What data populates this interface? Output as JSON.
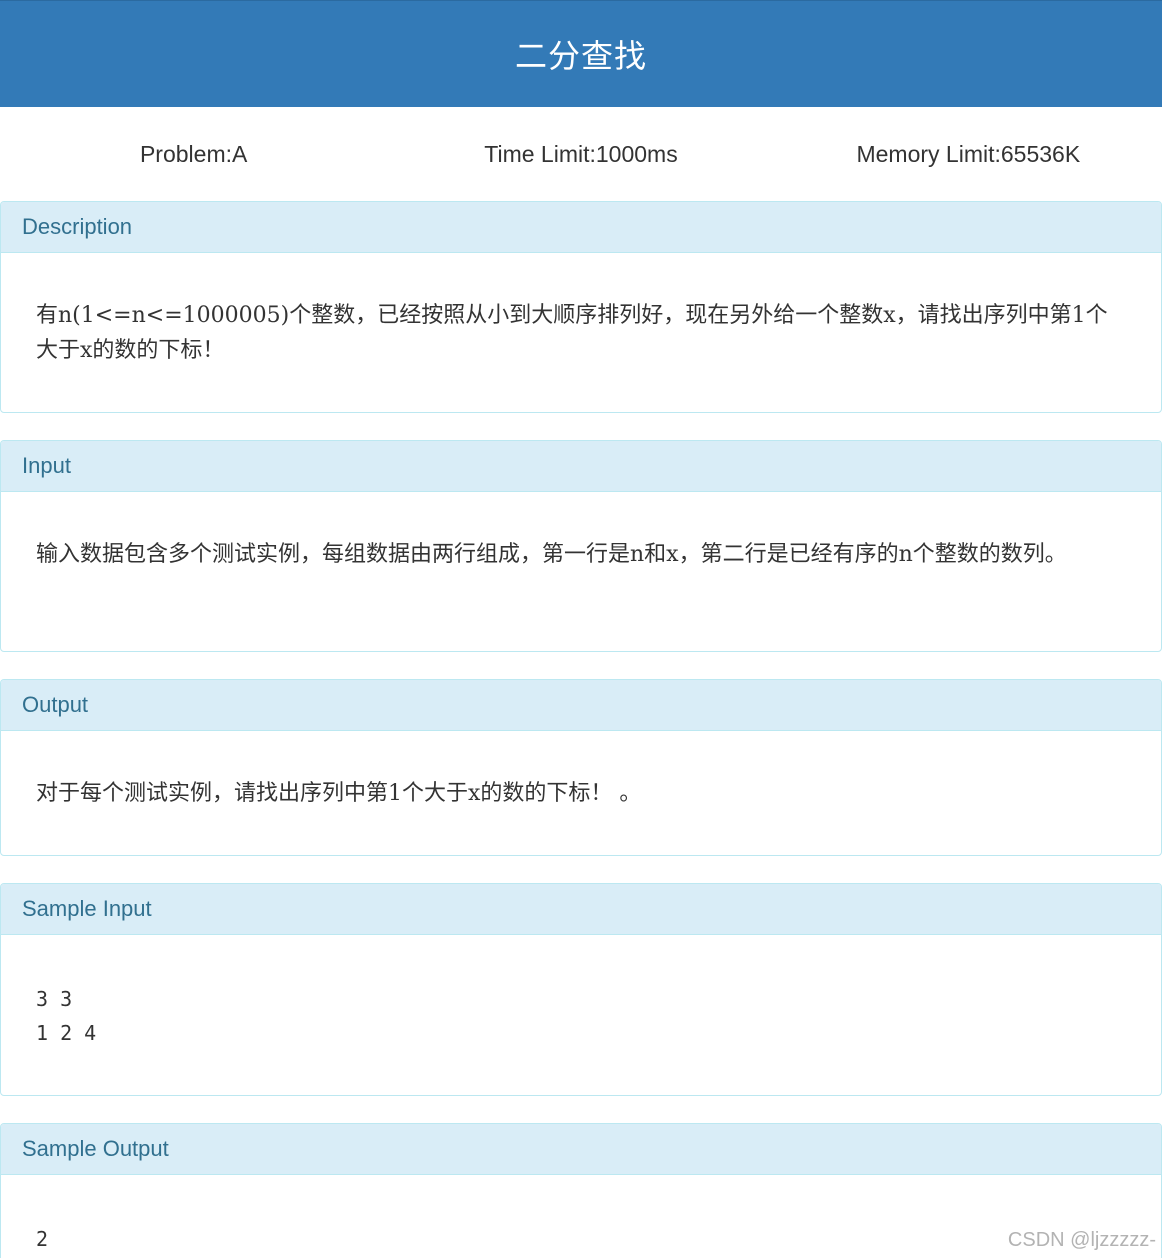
{
  "header": {
    "title": "二分查找"
  },
  "meta": {
    "problem": "Problem:A",
    "time_limit": "Time Limit:1000ms",
    "memory_limit": "Memory Limit:65536K"
  },
  "sections": {
    "description": {
      "heading": "Description",
      "text": "有n(1<=n<=1000005)个整数，已经按照从小到大顺序排列好，现在另外给一个整数x，请找出序列中第1个大于x的数的下标！"
    },
    "input": {
      "heading": "Input",
      "text": "输入数据包含多个测试实例，每组数据由两行组成，第一行是n和x，第二行是已经有序的n个整数的数列。"
    },
    "output": {
      "heading": "Output",
      "text": "对于每个测试实例，请找出序列中第1个大于x的数的下标！ 。"
    },
    "sample_input": {
      "heading": "Sample Input",
      "lines": [
        "3 3",
        "1 2 4"
      ]
    },
    "sample_output": {
      "heading": "Sample Output",
      "lines": [
        "2"
      ]
    }
  },
  "watermark": "CSDN @ljzzzzz-",
  "colors": {
    "header_bg": "#337ab7",
    "panel_heading_bg": "#d9edf7",
    "panel_border": "#bce8f1",
    "panel_heading_text": "#31708f"
  }
}
